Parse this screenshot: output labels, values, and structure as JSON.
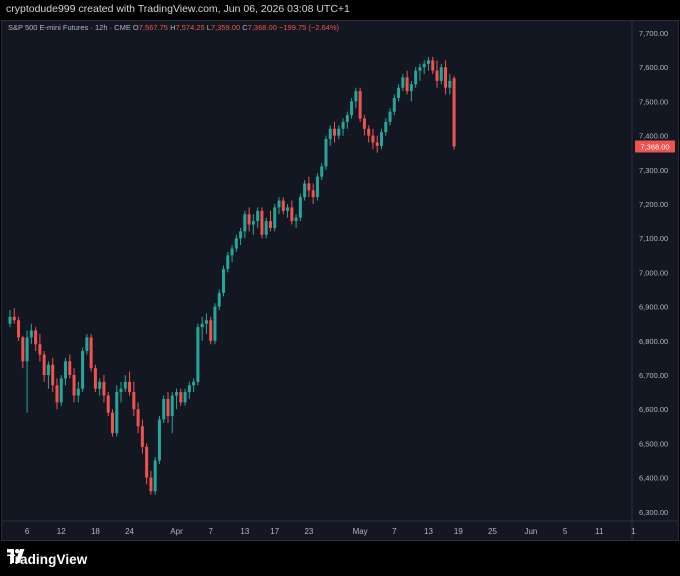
{
  "caption": "cryptodude999 created with TradingView.com, Jun 06, 2026 03:08 UTC+1",
  "footer": {
    "brand": "TradingView",
    "logo_icon": "tradingview-logo-icon"
  },
  "legend": {
    "symbol": "S&P 500 E-mini Futures · 12h · CME",
    "o_key": "O",
    "o_val": "7,567.75",
    "h_key": "H",
    "h_val": "7,574.25",
    "l_key": "L",
    "l_val": "7,359.00",
    "c_key": "C",
    "c_val": "7,368.00",
    "change": "−199.75 (−2.64%)"
  },
  "colors": {
    "up": "#26a69a",
    "down": "#ef5350",
    "background": "#131722",
    "grid": "#1e222d",
    "text": "#b2b5be"
  },
  "chart_data": {
    "type": "candlestick",
    "title": "S&P 500 E-mini Futures · 12h · CME",
    "ylim": [
      6270,
      7740
    ],
    "grid": false,
    "y_ticks": [
      7700,
      7600,
      7500,
      7400,
      7300,
      7200,
      7100,
      7000,
      6900,
      6800,
      6700,
      6600,
      6500,
      6400,
      6300
    ],
    "y_tick_labels": [
      "7,700.00",
      "7,600.00",
      "7,500.00",
      "7,400.00",
      "7,300.00",
      "7,200.00",
      "7,100.00",
      "7,000.00",
      "6,900.00",
      "6,800.00",
      "6,700.00",
      "6,600.00",
      "6,500.00",
      "6,400.00",
      "6,300.00"
    ],
    "x_ticks": [
      {
        "label": "6",
        "index": 4
      },
      {
        "label": "12",
        "index": 12
      },
      {
        "label": "18",
        "index": 20
      },
      {
        "label": "24",
        "index": 28
      },
      {
        "label": "Apr",
        "index": 39
      },
      {
        "label": "7",
        "index": 47
      },
      {
        "label": "13",
        "index": 55
      },
      {
        "label": "17",
        "index": 62
      },
      {
        "label": "23",
        "index": 70
      },
      {
        "label": "May",
        "index": 82
      },
      {
        "label": "7",
        "index": 90
      },
      {
        "label": "13",
        "index": 98
      },
      {
        "label": "19",
        "index": 105
      },
      {
        "label": "25",
        "index": 113
      },
      {
        "label": "Jun",
        "index": 122
      },
      {
        "label": "5",
        "index": 130
      },
      {
        "label": "11",
        "index": 138
      },
      {
        "label": "1",
        "index": 146
      }
    ],
    "last_price": 7368.0,
    "last_price_label": "7,368.00",
    "candles": [
      [
        6850,
        6890,
        6840,
        6870
      ],
      [
        6870,
        6895,
        6850,
        6860
      ],
      [
        6860,
        6870,
        6800,
        6810
      ],
      [
        6810,
        6815,
        6720,
        6740
      ],
      [
        6740,
        6830,
        6590,
        6810
      ],
      [
        6810,
        6850,
        6790,
        6830
      ],
      [
        6830,
        6840,
        6770,
        6790
      ],
      [
        6790,
        6820,
        6740,
        6760
      ],
      [
        6760,
        6770,
        6680,
        6700
      ],
      [
        6700,
        6740,
        6660,
        6730
      ],
      [
        6730,
        6750,
        6650,
        6670
      ],
      [
        6670,
        6690,
        6600,
        6620
      ],
      [
        6620,
        6700,
        6610,
        6690
      ],
      [
        6690,
        6750,
        6670,
        6740
      ],
      [
        6740,
        6760,
        6690,
        6700
      ],
      [
        6700,
        6720,
        6620,
        6640
      ],
      [
        6640,
        6680,
        6620,
        6660
      ],
      [
        6660,
        6780,
        6650,
        6770
      ],
      [
        6770,
        6820,
        6760,
        6810
      ],
      [
        6810,
        6820,
        6710,
        6720
      ],
      [
        6720,
        6730,
        6650,
        6660
      ],
      [
        6660,
        6690,
        6640,
        6680
      ],
      [
        6680,
        6700,
        6620,
        6640
      ],
      [
        6640,
        6650,
        6580,
        6590
      ],
      [
        6590,
        6600,
        6520,
        6530
      ],
      [
        6530,
        6670,
        6520,
        6650
      ],
      [
        6650,
        6680,
        6620,
        6660
      ],
      [
        6660,
        6700,
        6650,
        6680
      ],
      [
        6680,
        6710,
        6640,
        6650
      ],
      [
        6650,
        6680,
        6580,
        6600
      ],
      [
        6600,
        6620,
        6530,
        6550
      ],
      [
        6550,
        6570,
        6470,
        6490
      ],
      [
        6490,
        6500,
        6380,
        6400
      ],
      [
        6400,
        6420,
        6350,
        6360
      ],
      [
        6360,
        6460,
        6350,
        6450
      ],
      [
        6450,
        6580,
        6440,
        6570
      ],
      [
        6570,
        6640,
        6560,
        6630
      ],
      [
        6630,
        6650,
        6560,
        6580
      ],
      [
        6580,
        6650,
        6530,
        6640
      ],
      [
        6640,
        6660,
        6600,
        6650
      ],
      [
        6650,
        6660,
        6610,
        6620
      ],
      [
        6620,
        6660,
        6610,
        6650
      ],
      [
        6650,
        6680,
        6630,
        6670
      ],
      [
        6670,
        6690,
        6650,
        6680
      ],
      [
        6680,
        6850,
        6670,
        6840
      ],
      [
        6840,
        6870,
        6800,
        6850
      ],
      [
        6850,
        6880,
        6820,
        6860
      ],
      [
        6860,
        6870,
        6790,
        6800
      ],
      [
        6800,
        6910,
        6790,
        6900
      ],
      [
        6900,
        6950,
        6890,
        6940
      ],
      [
        6940,
        7020,
        6930,
        7010
      ],
      [
        7010,
        7060,
        7000,
        7050
      ],
      [
        7050,
        7080,
        7030,
        7070
      ],
      [
        7070,
        7110,
        7060,
        7100
      ],
      [
        7100,
        7130,
        7080,
        7120
      ],
      [
        7120,
        7180,
        7100,
        7170
      ],
      [
        7170,
        7190,
        7120,
        7140
      ],
      [
        7140,
        7170,
        7110,
        7150
      ],
      [
        7150,
        7190,
        7130,
        7180
      ],
      [
        7180,
        7190,
        7100,
        7110
      ],
      [
        7110,
        7160,
        7100,
        7150
      ],
      [
        7150,
        7180,
        7120,
        7130
      ],
      [
        7130,
        7200,
        7120,
        7190
      ],
      [
        7190,
        7220,
        7170,
        7210
      ],
      [
        7210,
        7220,
        7170,
        7180
      ],
      [
        7180,
        7200,
        7160,
        7190
      ],
      [
        7190,
        7210,
        7140,
        7150
      ],
      [
        7150,
        7170,
        7130,
        7160
      ],
      [
        7160,
        7230,
        7150,
        7220
      ],
      [
        7220,
        7270,
        7210,
        7260
      ],
      [
        7260,
        7280,
        7220,
        7240
      ],
      [
        7240,
        7260,
        7200,
        7220
      ],
      [
        7220,
        7290,
        7210,
        7280
      ],
      [
        7280,
        7320,
        7270,
        7310
      ],
      [
        7310,
        7400,
        7300,
        7390
      ],
      [
        7390,
        7430,
        7370,
        7420
      ],
      [
        7420,
        7440,
        7380,
        7400
      ],
      [
        7400,
        7430,
        7390,
        7420
      ],
      [
        7420,
        7450,
        7400,
        7440
      ],
      [
        7440,
        7470,
        7420,
        7460
      ],
      [
        7460,
        7510,
        7450,
        7500
      ],
      [
        7500,
        7540,
        7480,
        7530
      ],
      [
        7530,
        7540,
        7440,
        7450
      ],
      [
        7450,
        7460,
        7400,
        7420
      ],
      [
        7420,
        7430,
        7380,
        7400
      ],
      [
        7400,
        7420,
        7360,
        7380
      ],
      [
        7380,
        7400,
        7350,
        7370
      ],
      [
        7370,
        7420,
        7360,
        7410
      ],
      [
        7410,
        7450,
        7400,
        7440
      ],
      [
        7440,
        7480,
        7430,
        7470
      ],
      [
        7470,
        7520,
        7460,
        7510
      ],
      [
        7510,
        7550,
        7500,
        7540
      ],
      [
        7540,
        7580,
        7530,
        7570
      ],
      [
        7570,
        7590,
        7520,
        7530
      ],
      [
        7530,
        7560,
        7500,
        7550
      ],
      [
        7550,
        7600,
        7540,
        7590
      ],
      [
        7590,
        7610,
        7560,
        7600
      ],
      [
        7600,
        7620,
        7580,
        7610
      ],
      [
        7610,
        7630,
        7590,
        7620
      ],
      [
        7620,
        7630,
        7580,
        7590
      ],
      [
        7590,
        7620,
        7540,
        7560
      ],
      [
        7560,
        7610,
        7550,
        7600
      ],
      [
        7600,
        7620,
        7520,
        7540
      ],
      [
        7540,
        7580,
        7520,
        7560
      ],
      [
        7567.75,
        7574.25,
        7359,
        7368
      ]
    ]
  }
}
